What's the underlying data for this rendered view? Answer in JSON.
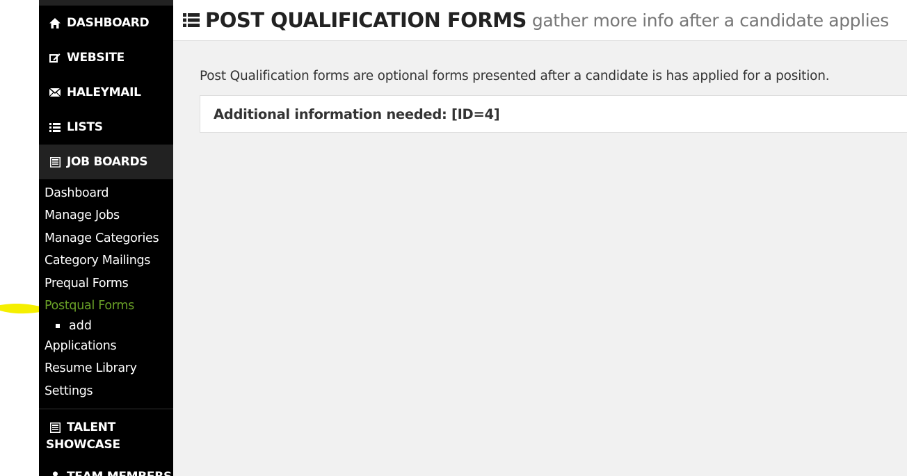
{
  "header": {
    "title": "POST QUALIFICATION FORMS",
    "subtitle": "gather more info after a candidate applies",
    "icon": "list-icon"
  },
  "sidebar": {
    "items": [
      {
        "label": "DASHBOARD",
        "icon": "home-icon"
      },
      {
        "label": "WEBSITE",
        "icon": "edit-icon"
      },
      {
        "label": "HALEYMAIL",
        "icon": "envelope-icon"
      },
      {
        "label": "LISTS",
        "icon": "list-icon"
      },
      {
        "label": "JOB BOARDS",
        "icon": "newspaper-icon",
        "active": true
      },
      {
        "label": "TALENT SHOWCASE",
        "label_line1": "TALENT",
        "label_line2": "SHOWCASE",
        "icon": "newspaper-icon"
      },
      {
        "label": "TEAM MEMBERS",
        "icon": "user-icon"
      }
    ],
    "job_boards_sub": [
      {
        "label": "Dashboard"
      },
      {
        "label": "Manage Jobs"
      },
      {
        "label": "Manage Categories"
      },
      {
        "label": "Category Mailings"
      },
      {
        "label": "Prequal Forms"
      },
      {
        "label": "Postqual Forms",
        "current": true
      },
      {
        "label": "Applications"
      },
      {
        "label": "Resume Library"
      },
      {
        "label": "Settings"
      }
    ],
    "postqual_sub": [
      {
        "label": "add"
      }
    ]
  },
  "main": {
    "intro": "Post Qualification forms are optional forms presented after a candidate is has applied for a position.",
    "forms": [
      {
        "title": "Additional information needed: [ID=4]"
      }
    ]
  },
  "colors": {
    "sidebar_bg": "#000000",
    "active_bg": "#222222",
    "current_link": "#6aa127",
    "highlight": "#f5ef00",
    "main_bg": "#f1f1f1"
  }
}
